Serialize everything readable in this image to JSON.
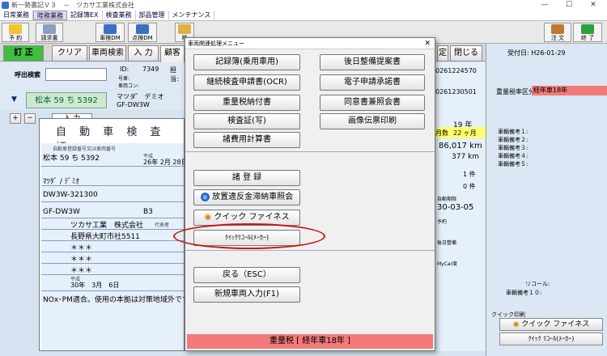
{
  "window": {
    "title": "新一勢書記Ｖ３　－　ツカサ工業株式会社",
    "min": "—",
    "max": "☐",
    "close": "✕"
  },
  "menubar": [
    "日常業務",
    "陸務業務",
    "記録簿EX",
    "検査業務",
    "部品管理",
    "メンテナンス"
  ],
  "toolbar": [
    {
      "label": "予 約",
      "icon": "calendar-icon"
    },
    {
      "label": "請求書",
      "icon": "invoice-icon"
    },
    {
      "label": "車検DM",
      "icon": "dm-icon"
    },
    {
      "label": "点検DM",
      "icon": "dm-icon"
    },
    {
      "label": "検",
      "icon": "search-icon"
    },
    {
      "label": "注 文",
      "icon": "order-icon"
    },
    {
      "label": "終 了",
      "icon": "exit-icon"
    }
  ],
  "actionbar": {
    "correct": "訂 正",
    "clear": "クリア",
    "vehicle_search": "車両検索",
    "input": "入 力",
    "customer": "顧客補",
    "settle": "定",
    "close": "閉じる"
  },
  "left": {
    "call_search": "呼出検索",
    "id_label": "ID:",
    "id_value": "7349",
    "owner_label": "担当:",
    "model_label": "号車:",
    "name_label": "車両コン:",
    "plate": "松本 59 ち 5392",
    "model_kana": "マツダ゛ デミオ",
    "model_code": "GF-DW3W",
    "tab_input": "入 力",
    "plus": "+",
    "minus": "−"
  },
  "card": {
    "title": "自 動 車 検 査 証",
    "reg_number_label": "自動車登録番号又は車両番号",
    "reg_number": "松本 59 ち 5392",
    "first_reg_year": "26",
    "first_reg_month": "2",
    "first_reg_day": "28",
    "first_reg_fmt": "平成",
    "name": "ﾏﾂﾀﾞ / ﾃﾞﾐｵ",
    "serial": "DW3W-321300",
    "model": "GF-DW3W",
    "engine": "B3",
    "owner": "ツカサ工業　株式会社",
    "owner_rep": "代表者",
    "address": "長野県大町市社5511",
    "user": "＊＊＊",
    "user_addr": "＊＊＊",
    "base": "＊＊＊",
    "expiry": "30年　3月　6日",
    "expiry_era": "平成",
    "notes": "NOx･PM適合。使用の本拠は対策地域外です。"
  },
  "middle_side": {
    "phone1": "0261224570",
    "phone2": "0261230501",
    "inspection_months": "19 年",
    "remaining_label": "月数",
    "remaining": "22 ヶ月",
    "km": "86,017 km",
    "km2": "377 km",
    "count1": "1 件",
    "count2": "0 件",
    "expiry_label": "自動期限",
    "expiry_value": "30-03-05",
    "reserve_label": "予約",
    "later_label": "後日整備",
    "mycar_label": "MyCar度"
  },
  "right": {
    "reception": "受付日: H26-01-29",
    "weight_tax_label": "重量税率区分:",
    "weight_tax_value": "経年車18年",
    "notes": [
      "車輌備考１:",
      "車輌備考２:",
      "車輌備考３:",
      "車輌備考４:",
      "車輌備考５:"
    ],
    "recall_label": "リコール:",
    "notes10": "車輌備考１０:",
    "quick_print": "クイック印刷",
    "quick_finesse": "クイック ファイネス",
    "quick_recall": "ｸｲｯｸ ﾘｺｰﾙ(ﾒｰｶｰ)"
  },
  "modal": {
    "title": "車両関連処理メニュー",
    "close": "✕",
    "left_buttons": [
      "記録簿(乗用車用)",
      "継続検査申請書(OCR)",
      "重量税納付書",
      "検査証(写)",
      "諸費用計算書",
      "諸 登 録",
      "放置違反金滞納車照会",
      "クイック ファイネス",
      "ｸｲｯｸﾘｺｰﾙ(ﾒｰｶｰ)",
      "戻る（ESC）",
      "新規車両入力(F1)"
    ],
    "right_buttons": [
      "後日整備提案書",
      "電子申請承諾書",
      "同意書兼照会書",
      "画像伝票印刷"
    ],
    "footer": "重量税 [ 経年車18年 ]"
  }
}
